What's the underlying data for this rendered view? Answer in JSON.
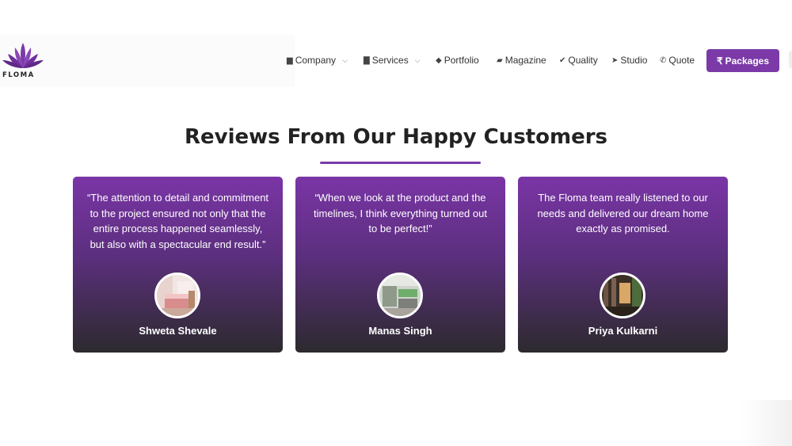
{
  "brand": {
    "name": "FLOMA",
    "accent": "#7b3aa8"
  },
  "nav": {
    "items": [
      {
        "label": "Company",
        "icon": "building-icon",
        "dropdown": true
      },
      {
        "label": "Services",
        "icon": "briefcase-icon",
        "dropdown": true
      },
      {
        "label": "Portfolio",
        "icon": "tags-icon",
        "dropdown": false
      },
      {
        "label": "Magazine",
        "icon": "book-icon",
        "dropdown": false
      },
      {
        "label": "Quality",
        "icon": "check-icon",
        "dropdown": false
      },
      {
        "label": "Studio",
        "icon": "location-arrow-icon",
        "dropdown": false
      },
      {
        "label": "Quote",
        "icon": "phone-icon",
        "dropdown": false
      }
    ],
    "cta": {
      "label": "Packages",
      "icon": "rupee-icon"
    }
  },
  "reviews": {
    "title": "Reviews From Our Happy Customers",
    "cards": [
      {
        "quote": "“The attention to detail and commitment to the project ensured not only that the entire process happened seamlessly, but also with a spectacular end result.”",
        "name": "Shweta Shevale"
      },
      {
        "quote": "“When we look at the product and the timelines, I think everything turned out to be perfect!”",
        "name": "Manas Singh"
      },
      {
        "quote": "The Floma team really listened to our needs and delivered our dream home exactly as promised.",
        "name": "Priya Kulkarni"
      }
    ]
  }
}
